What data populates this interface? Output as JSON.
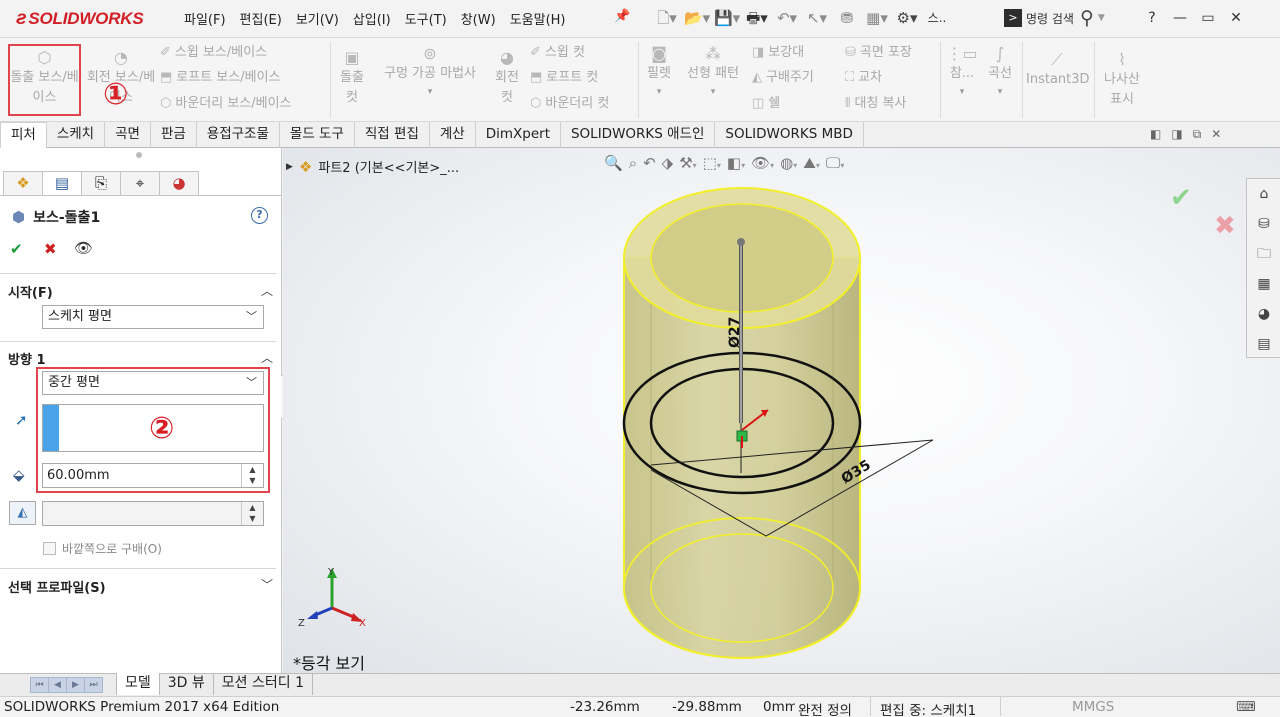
{
  "app": {
    "logo_text": "SOLIDWORKS",
    "brand_color": "#d11f26",
    "menu": [
      "파일(F)",
      "편집(E)",
      "보기(V)",
      "삽입(I)",
      "도구(T)",
      "창(W)",
      "도움말(H)"
    ],
    "quick_toolbar_extra_label": "스..",
    "command_search_placeholder": "명령 검색",
    "window_controls": [
      "?",
      "—",
      "▭",
      "✕"
    ]
  },
  "ribbon": {
    "extruded_boss": "돌출 보스/베이스",
    "revolved_boss": "회전 보스/베이스",
    "swept_boss": "스윕 보스/베이스",
    "lofted_boss": "로프트 보스/베이스",
    "boundary_boss": "바운더리 보스/베이스",
    "extruded_cut": "돌출 컷",
    "hole_wizard": "구멍 가공 마법사",
    "revolved_cut": "회전 컷",
    "swept_cut": "스윕 컷",
    "lofted_cut": "로프트 컷",
    "boundary_cut": "바운더리 컷",
    "fillet": "필렛",
    "linear_pattern": "선형 패턴",
    "rib": "보강대",
    "draft": "구배주기",
    "shell": "쉘",
    "wrap": "곡면 포장",
    "intersect": "교차",
    "mirror": "대칭 복사",
    "reference": "참...",
    "curves": "곡선",
    "instant3d": "Instant3D",
    "thread": "나사산 표시",
    "annotation_1": "①"
  },
  "tabs": [
    "피처",
    "스케치",
    "곡면",
    "판금",
    "용접구조물",
    "몰드 도구",
    "직접 편집",
    "계산",
    "DimXpert",
    "SOLIDWORKS 애드인",
    "SOLIDWORKS MBD"
  ],
  "property_manager": {
    "title": "보스-돌출1",
    "help": "?",
    "start_section": "시작(F)",
    "start_value": "스케치 평면",
    "direction_section": "방향 1",
    "end_condition": "중간 평면",
    "annotation_2": "②",
    "depth_value": "60.00mm",
    "draft_value": "",
    "draft_outward_label": "바깥쪽으로 구배(O)",
    "profile_section": "선택 프로파일(S)"
  },
  "viewport": {
    "tree_node": "파트2  (기본<<기본>_...",
    "view_name": "*등각 보기",
    "dim_inner": "Ø27",
    "dim_outer": "Ø35",
    "axis_x": "X",
    "axis_y": "Y",
    "axis_z": "Z"
  },
  "bottom_tabs": [
    "모델",
    "3D 뷰",
    "모션 스터디 1"
  ],
  "status": {
    "edition": "SOLIDWORKS Premium 2017 x64 Edition",
    "x": "-23.26mm",
    "y": "-29.88mm",
    "z": "0mm",
    "definition": "완전 정의",
    "editing": "편집 중: 스케치1",
    "units": "MMGS"
  },
  "colors": {
    "annotation_red": "#d81f26",
    "cylinder_fill": "#c9c489",
    "cylinder_edge": "#f3ef2a",
    "selection_blue": "#4ba3ea"
  }
}
